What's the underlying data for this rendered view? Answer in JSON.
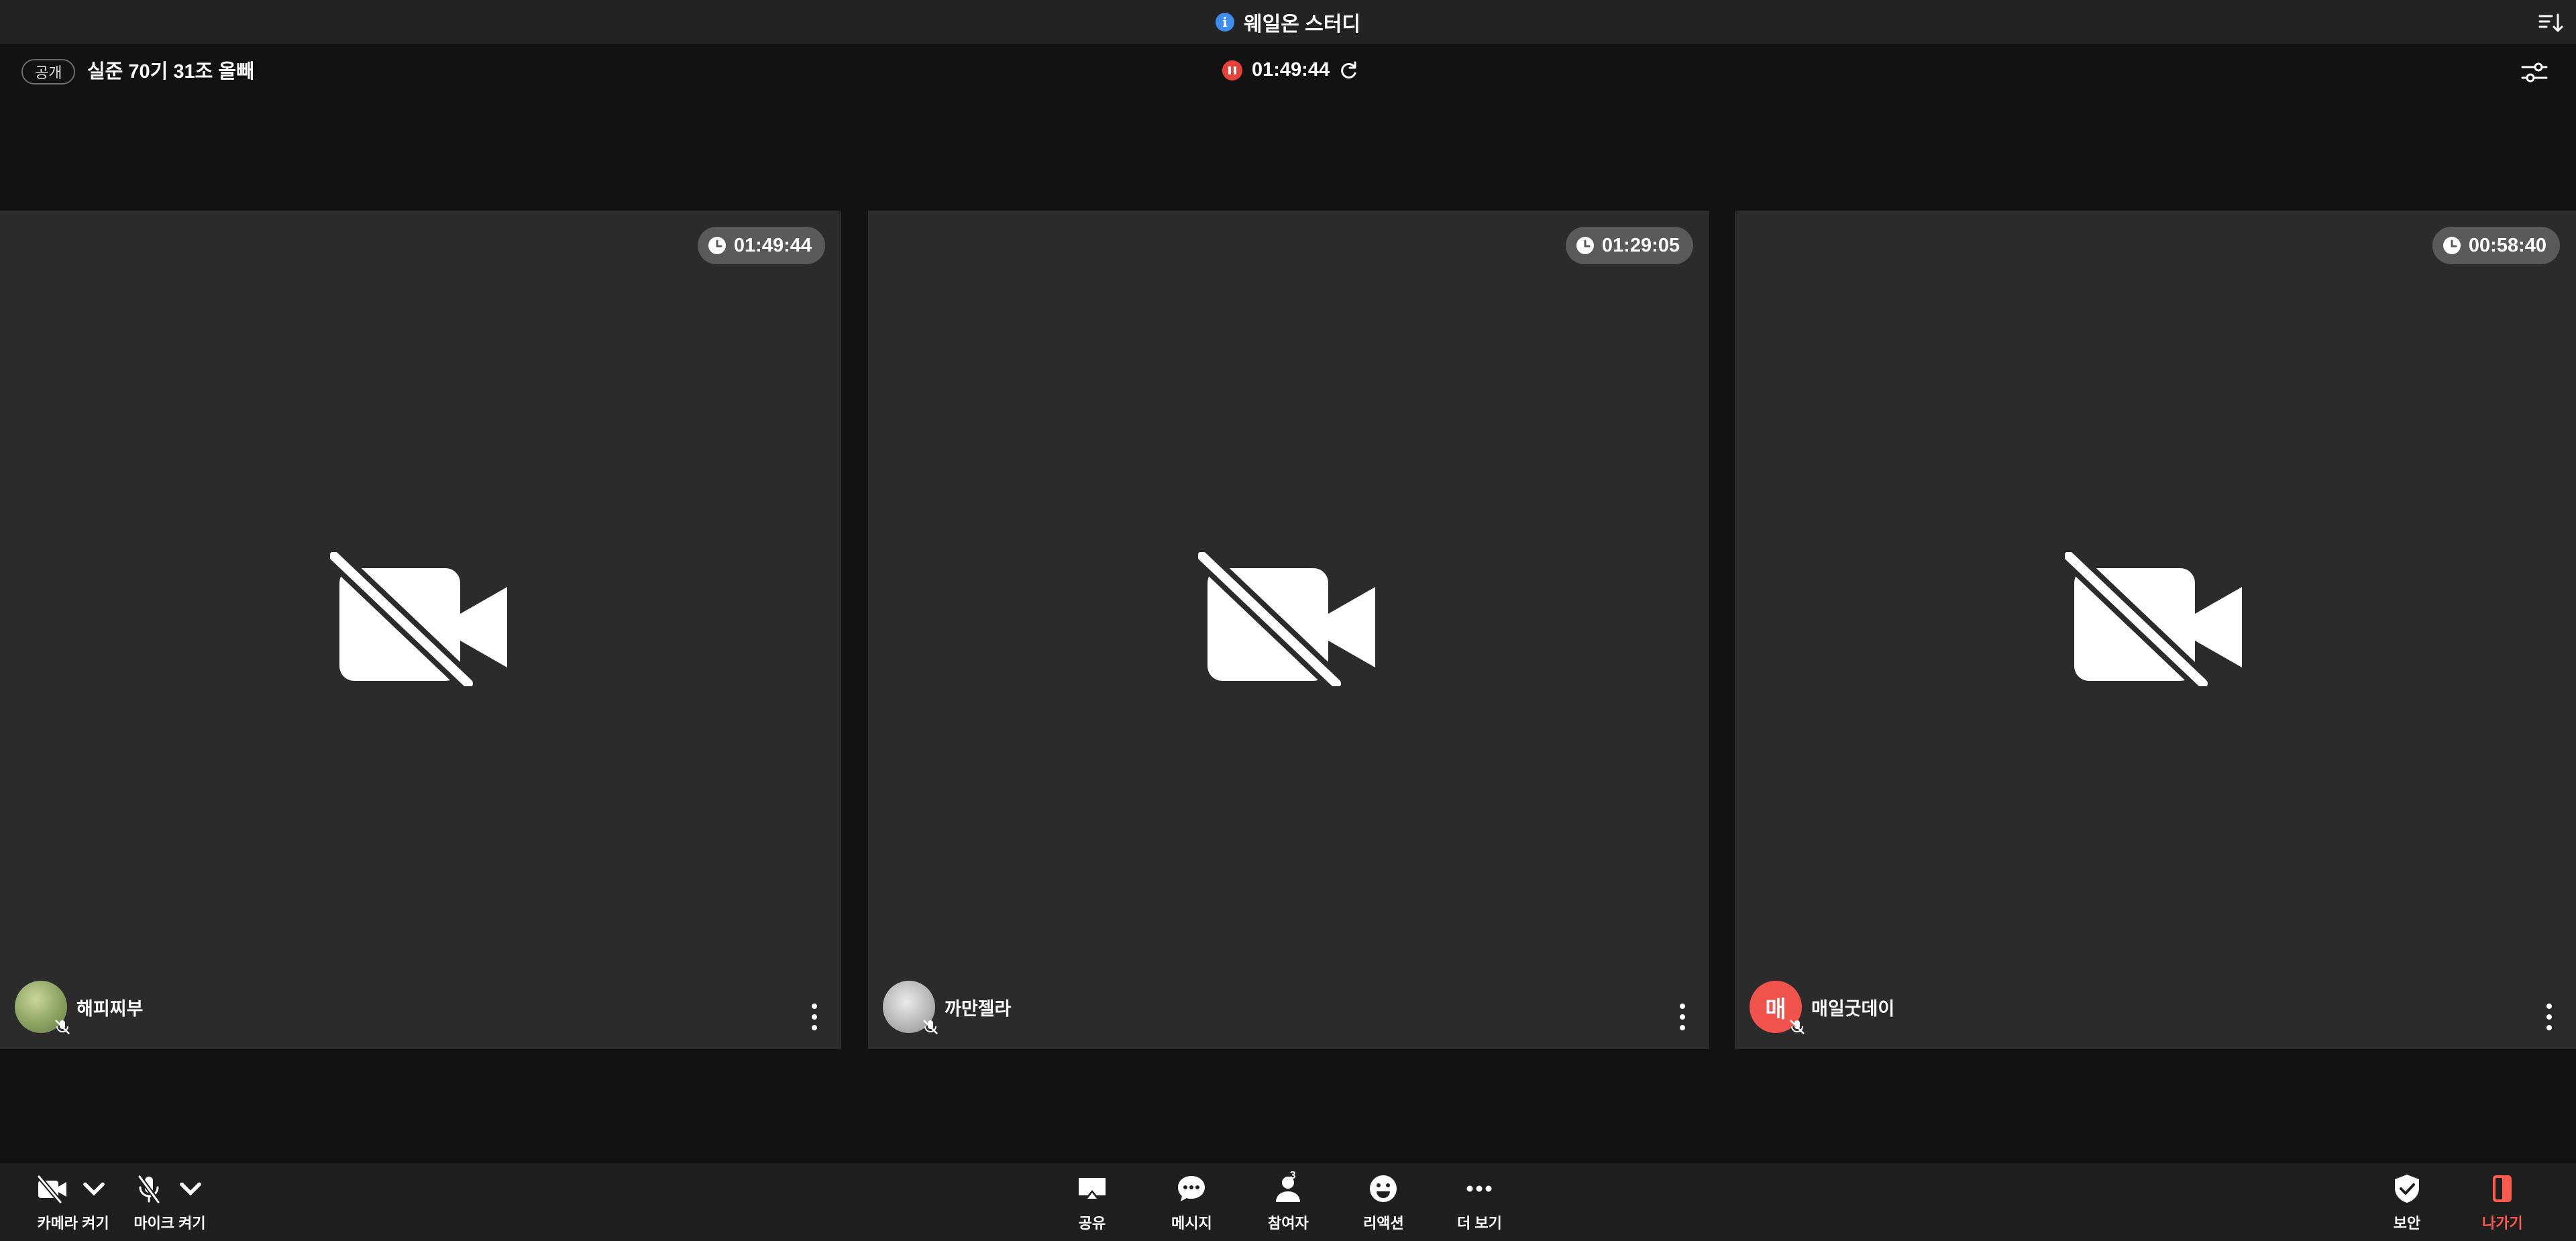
{
  "window": {
    "title": "웨일온 스터디"
  },
  "header": {
    "visibility_badge": "공개",
    "meeting_name": "실준 70기 31조 올빼",
    "recording_time": "01:49:44"
  },
  "participants": [
    {
      "name": "해피찌부",
      "timer": "01:49:44",
      "avatar_letter": "",
      "avatar_style": "photo-green"
    },
    {
      "name": "까만젤라",
      "timer": "01:29:05",
      "avatar_letter": "",
      "avatar_style": "photo-gray"
    },
    {
      "name": "매일굿데이",
      "timer": "00:58:40",
      "avatar_letter": "매",
      "avatar_style": "letter-red"
    }
  ],
  "toolbar": {
    "camera_label": "카메라 켜기",
    "mic_label": "마이크 켜기",
    "share_label": "공유",
    "message_label": "메시지",
    "participants_label": "참여자",
    "participants_count": "3",
    "reaction_label": "리액션",
    "more_label": "더 보기",
    "security_label": "보안",
    "leave_label": "나가기"
  },
  "colors": {
    "accent_info": "#3d8ef0",
    "recording_red": "#e8413a",
    "leave_red": "#ff5a4e",
    "tile_bg": "#2b2b2b",
    "page_bg": "#121212"
  },
  "icons": [
    "info-icon",
    "sort-list-icon",
    "pause-icon",
    "refresh-icon",
    "settings-sliders-icon",
    "clock-icon",
    "camera-off-icon",
    "mic-off-icon",
    "chevron-down-icon",
    "share-screen-icon",
    "chat-icon",
    "person-icon",
    "smile-icon",
    "more-dots-icon",
    "shield-check-icon",
    "leave-door-icon",
    "kebab-menu-icon"
  ]
}
